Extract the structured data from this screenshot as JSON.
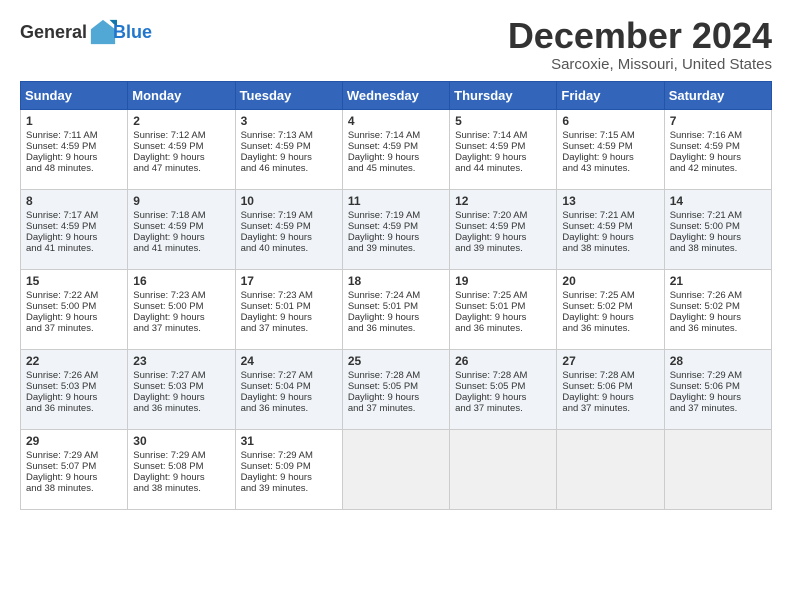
{
  "logo": {
    "general": "General",
    "blue": "Blue"
  },
  "title": {
    "month": "December 2024",
    "location": "Sarcoxie, Missouri, United States"
  },
  "headers": [
    "Sunday",
    "Monday",
    "Tuesday",
    "Wednesday",
    "Thursday",
    "Friday",
    "Saturday"
  ],
  "weeks": [
    [
      {
        "day": "1",
        "lines": [
          "Sunrise: 7:11 AM",
          "Sunset: 4:59 PM",
          "Daylight: 9 hours",
          "and 48 minutes."
        ]
      },
      {
        "day": "2",
        "lines": [
          "Sunrise: 7:12 AM",
          "Sunset: 4:59 PM",
          "Daylight: 9 hours",
          "and 47 minutes."
        ]
      },
      {
        "day": "3",
        "lines": [
          "Sunrise: 7:13 AM",
          "Sunset: 4:59 PM",
          "Daylight: 9 hours",
          "and 46 minutes."
        ]
      },
      {
        "day": "4",
        "lines": [
          "Sunrise: 7:14 AM",
          "Sunset: 4:59 PM",
          "Daylight: 9 hours",
          "and 45 minutes."
        ]
      },
      {
        "day": "5",
        "lines": [
          "Sunrise: 7:14 AM",
          "Sunset: 4:59 PM",
          "Daylight: 9 hours",
          "and 44 minutes."
        ]
      },
      {
        "day": "6",
        "lines": [
          "Sunrise: 7:15 AM",
          "Sunset: 4:59 PM",
          "Daylight: 9 hours",
          "and 43 minutes."
        ]
      },
      {
        "day": "7",
        "lines": [
          "Sunrise: 7:16 AM",
          "Sunset: 4:59 PM",
          "Daylight: 9 hours",
          "and 42 minutes."
        ]
      }
    ],
    [
      {
        "day": "8",
        "lines": [
          "Sunrise: 7:17 AM",
          "Sunset: 4:59 PM",
          "Daylight: 9 hours",
          "and 41 minutes."
        ]
      },
      {
        "day": "9",
        "lines": [
          "Sunrise: 7:18 AM",
          "Sunset: 4:59 PM",
          "Daylight: 9 hours",
          "and 41 minutes."
        ]
      },
      {
        "day": "10",
        "lines": [
          "Sunrise: 7:19 AM",
          "Sunset: 4:59 PM",
          "Daylight: 9 hours",
          "and 40 minutes."
        ]
      },
      {
        "day": "11",
        "lines": [
          "Sunrise: 7:19 AM",
          "Sunset: 4:59 PM",
          "Daylight: 9 hours",
          "and 39 minutes."
        ]
      },
      {
        "day": "12",
        "lines": [
          "Sunrise: 7:20 AM",
          "Sunset: 4:59 PM",
          "Daylight: 9 hours",
          "and 39 minutes."
        ]
      },
      {
        "day": "13",
        "lines": [
          "Sunrise: 7:21 AM",
          "Sunset: 4:59 PM",
          "Daylight: 9 hours",
          "and 38 minutes."
        ]
      },
      {
        "day": "14",
        "lines": [
          "Sunrise: 7:21 AM",
          "Sunset: 5:00 PM",
          "Daylight: 9 hours",
          "and 38 minutes."
        ]
      }
    ],
    [
      {
        "day": "15",
        "lines": [
          "Sunrise: 7:22 AM",
          "Sunset: 5:00 PM",
          "Daylight: 9 hours",
          "and 37 minutes."
        ]
      },
      {
        "day": "16",
        "lines": [
          "Sunrise: 7:23 AM",
          "Sunset: 5:00 PM",
          "Daylight: 9 hours",
          "and 37 minutes."
        ]
      },
      {
        "day": "17",
        "lines": [
          "Sunrise: 7:23 AM",
          "Sunset: 5:01 PM",
          "Daylight: 9 hours",
          "and 37 minutes."
        ]
      },
      {
        "day": "18",
        "lines": [
          "Sunrise: 7:24 AM",
          "Sunset: 5:01 PM",
          "Daylight: 9 hours",
          "and 36 minutes."
        ]
      },
      {
        "day": "19",
        "lines": [
          "Sunrise: 7:25 AM",
          "Sunset: 5:01 PM",
          "Daylight: 9 hours",
          "and 36 minutes."
        ]
      },
      {
        "day": "20",
        "lines": [
          "Sunrise: 7:25 AM",
          "Sunset: 5:02 PM",
          "Daylight: 9 hours",
          "and 36 minutes."
        ]
      },
      {
        "day": "21",
        "lines": [
          "Sunrise: 7:26 AM",
          "Sunset: 5:02 PM",
          "Daylight: 9 hours",
          "and 36 minutes."
        ]
      }
    ],
    [
      {
        "day": "22",
        "lines": [
          "Sunrise: 7:26 AM",
          "Sunset: 5:03 PM",
          "Daylight: 9 hours",
          "and 36 minutes."
        ]
      },
      {
        "day": "23",
        "lines": [
          "Sunrise: 7:27 AM",
          "Sunset: 5:03 PM",
          "Daylight: 9 hours",
          "and 36 minutes."
        ]
      },
      {
        "day": "24",
        "lines": [
          "Sunrise: 7:27 AM",
          "Sunset: 5:04 PM",
          "Daylight: 9 hours",
          "and 36 minutes."
        ]
      },
      {
        "day": "25",
        "lines": [
          "Sunrise: 7:28 AM",
          "Sunset: 5:05 PM",
          "Daylight: 9 hours",
          "and 37 minutes."
        ]
      },
      {
        "day": "26",
        "lines": [
          "Sunrise: 7:28 AM",
          "Sunset: 5:05 PM",
          "Daylight: 9 hours",
          "and 37 minutes."
        ]
      },
      {
        "day": "27",
        "lines": [
          "Sunrise: 7:28 AM",
          "Sunset: 5:06 PM",
          "Daylight: 9 hours",
          "and 37 minutes."
        ]
      },
      {
        "day": "28",
        "lines": [
          "Sunrise: 7:29 AM",
          "Sunset: 5:06 PM",
          "Daylight: 9 hours",
          "and 37 minutes."
        ]
      }
    ],
    [
      {
        "day": "29",
        "lines": [
          "Sunrise: 7:29 AM",
          "Sunset: 5:07 PM",
          "Daylight: 9 hours",
          "and 38 minutes."
        ]
      },
      {
        "day": "30",
        "lines": [
          "Sunrise: 7:29 AM",
          "Sunset: 5:08 PM",
          "Daylight: 9 hours",
          "and 38 minutes."
        ]
      },
      {
        "day": "31",
        "lines": [
          "Sunrise: 7:29 AM",
          "Sunset: 5:09 PM",
          "Daylight: 9 hours",
          "and 39 minutes."
        ]
      },
      {
        "day": "",
        "lines": []
      },
      {
        "day": "",
        "lines": []
      },
      {
        "day": "",
        "lines": []
      },
      {
        "day": "",
        "lines": []
      }
    ]
  ]
}
